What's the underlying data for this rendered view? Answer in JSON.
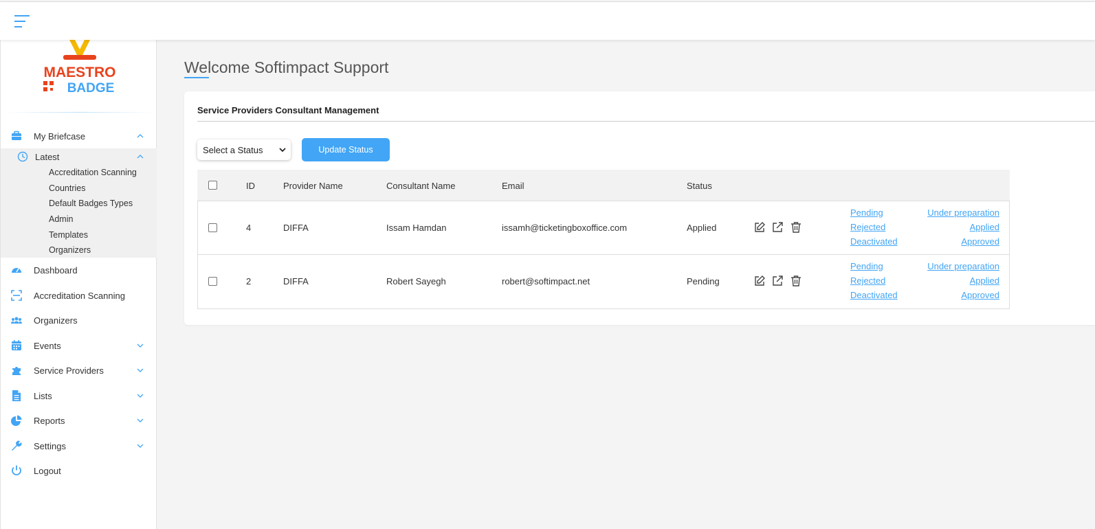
{
  "header": {
    "menu_icon": "hamburger-icon"
  },
  "sidebar": {
    "logo": {
      "line1": "MAESTRO",
      "line2": "BADGE"
    },
    "briefcase": {
      "label": "My Briefcase",
      "icon": "briefcase-icon"
    },
    "latest": {
      "label": "Latest",
      "icon": "clock-icon"
    },
    "latest_items": [
      "Accreditation Scanning",
      "Countries",
      "Default Badges Types",
      "Admin",
      "Templates",
      "Organizers"
    ],
    "items": [
      {
        "label": "Dashboard",
        "icon": "gauge-icon"
      },
      {
        "label": "Accreditation Scanning",
        "icon": "scan-icon"
      },
      {
        "label": "Organizers",
        "icon": "users-icon"
      },
      {
        "label": "Events",
        "icon": "calendar-icon"
      },
      {
        "label": "Service Providers",
        "icon": "puzzle-icon"
      },
      {
        "label": "Lists",
        "icon": "file-icon"
      },
      {
        "label": "Reports",
        "icon": "pie-chart-icon"
      },
      {
        "label": "Settings",
        "icon": "wrench-icon"
      },
      {
        "label": "Logout",
        "icon": "power-icon"
      }
    ]
  },
  "main": {
    "title": "Welcome Softimpact Support",
    "card_title": "Service Providers Consultant Management",
    "select_placeholder": "Select a Status",
    "update_button": "Update Status",
    "columns": [
      "ID",
      "Provider Name",
      "Consultant Name",
      "Email",
      "Status"
    ],
    "rows": [
      {
        "id": "4",
        "provider": "DIFFA",
        "consultant": "Issam Hamdan",
        "email": "issamh@ticketingboxoffice.com",
        "status": "Applied"
      },
      {
        "id": "2",
        "provider": "DIFFA",
        "consultant": "Robert Sayegh",
        "email": "robert@softimpact.net",
        "status": "Pending"
      }
    ],
    "status_links_left": [
      "Pending",
      "Rejected",
      "Deactivated"
    ],
    "status_links_right": [
      "Under preparation",
      "Applied",
      "Approved"
    ]
  },
  "colors": {
    "accent": "#42a5f5",
    "logo_red": "#e8431d",
    "logo_blue": "#42a5f5",
    "logo_yellow": "#f5b800"
  }
}
